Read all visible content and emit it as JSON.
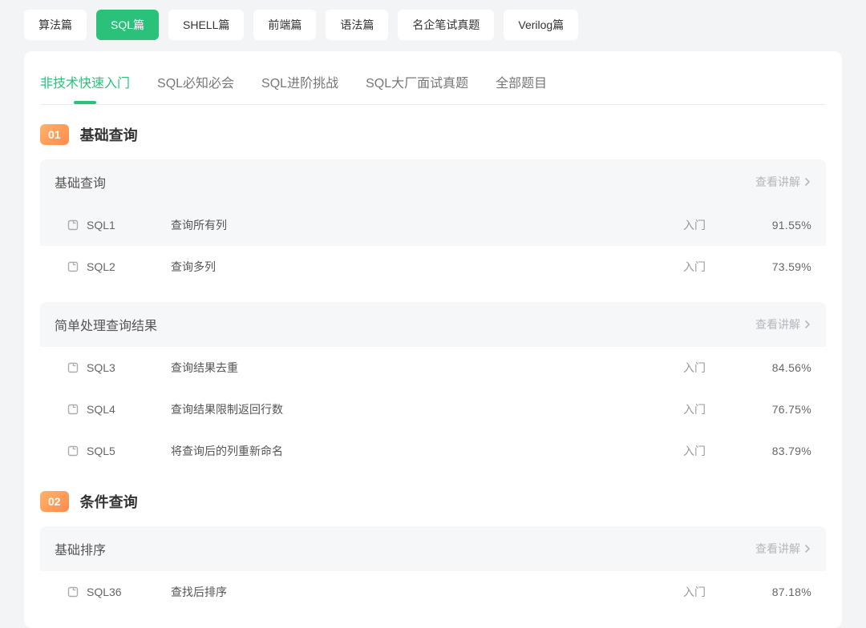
{
  "pills": [
    {
      "label": "算法篇",
      "active": false
    },
    {
      "label": "SQL篇",
      "active": true
    },
    {
      "label": "SHELL篇",
      "active": false
    },
    {
      "label": "前端篇",
      "active": false
    },
    {
      "label": "语法篇",
      "active": false
    },
    {
      "label": "名企笔试真题",
      "active": false
    },
    {
      "label": "Verilog篇",
      "active": false
    }
  ],
  "subtabs": [
    {
      "label": "非技术快速入门",
      "active": true
    },
    {
      "label": "SQL必知必会",
      "active": false
    },
    {
      "label": "SQL进阶挑战",
      "active": false
    },
    {
      "label": "SQL大厂面试真题",
      "active": false
    },
    {
      "label": "全部题目",
      "active": false
    }
  ],
  "view_explain": "查看讲解",
  "chapters": [
    {
      "num": "01",
      "title": "基础查询",
      "sections": [
        {
          "title": "基础查询",
          "rows": [
            {
              "code": "SQL1",
              "title": "查询所有列",
              "level": "入门",
              "pct": "91.55%",
              "hl": true
            },
            {
              "code": "SQL2",
              "title": "查询多列",
              "level": "入门",
              "pct": "73.59%",
              "hl": false
            }
          ]
        },
        {
          "title": "简单处理查询结果",
          "rows": [
            {
              "code": "SQL3",
              "title": "查询结果去重",
              "level": "入门",
              "pct": "84.56%",
              "hl": false
            },
            {
              "code": "SQL4",
              "title": "查询结果限制返回行数",
              "level": "入门",
              "pct": "76.75%",
              "hl": false
            },
            {
              "code": "SQL5",
              "title": "将查询后的列重新命名",
              "level": "入门",
              "pct": "83.79%",
              "hl": false
            }
          ]
        }
      ]
    },
    {
      "num": "02",
      "title": "条件查询",
      "sections": [
        {
          "title": "基础排序",
          "rows": [
            {
              "code": "SQL36",
              "title": "查找后排序",
              "level": "入门",
              "pct": "87.18%",
              "hl": false
            }
          ]
        }
      ]
    }
  ]
}
